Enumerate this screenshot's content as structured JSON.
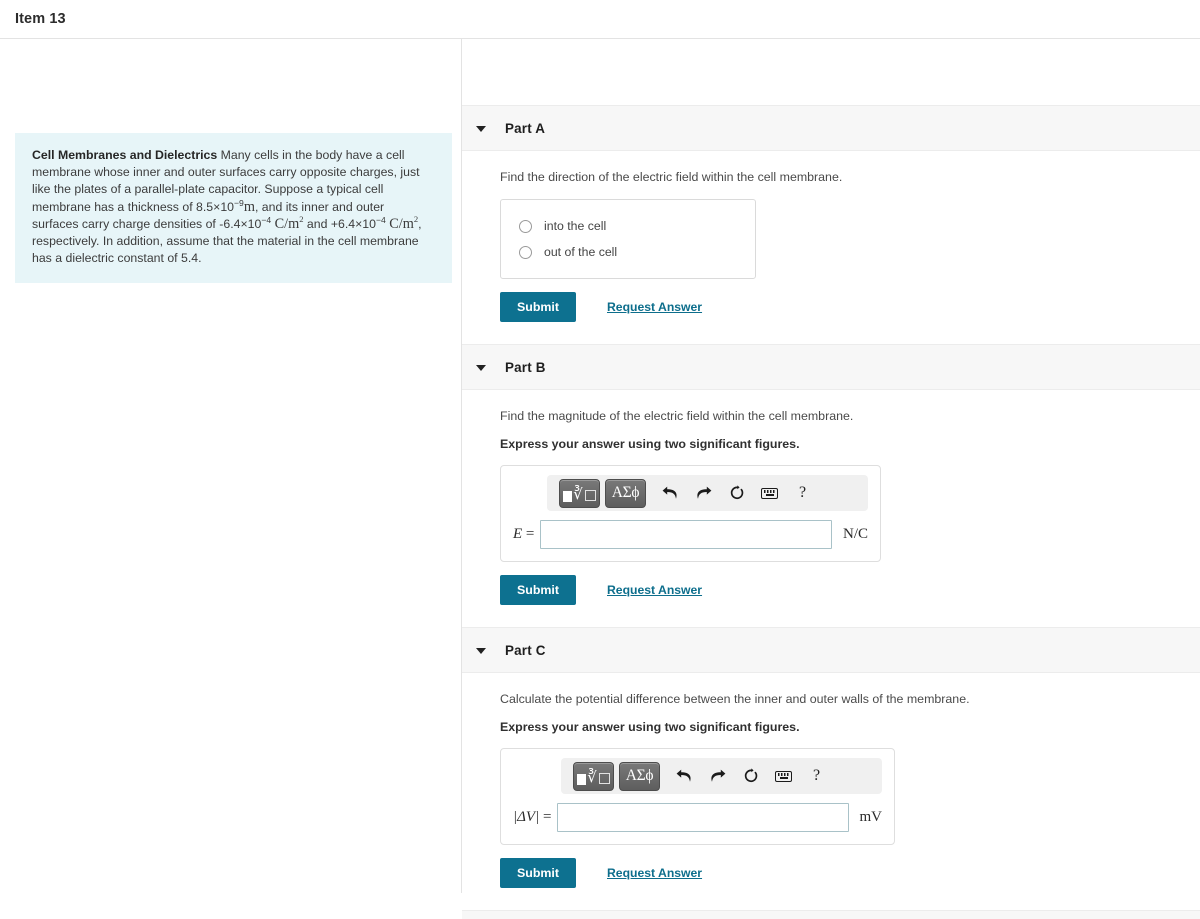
{
  "topbar": {
    "title": "Item 13"
  },
  "statement": {
    "heading": "Cell Membranes and Dielectrics",
    "text_1": " Many cells in the body have a cell membrane whose inner and outer surfaces carry opposite charges, just like the plates of a parallel-plate capacitor. Suppose a typical cell membrane has a thickness of 8.5×10",
    "exp_1": "−9",
    "unit_1": "m",
    "text_2": ", and its inner and outer surfaces carry charge densities of -6.4×10",
    "exp_2": "−4",
    "unit_2": "C/m",
    "unit_2_sup": "2",
    "text_3": " and +6.4×10",
    "exp_3": "−4",
    "unit_3": "C/m",
    "unit_3_sup": "2",
    "text_4": ", respectively. In addition, assume that the material in the cell membrane has a dielectric constant of 5.4."
  },
  "math_toolbar": {
    "template_button": "math-template-button",
    "greek_button": "ΑΣϕ",
    "undo": "undo-icon",
    "redo": "redo-icon",
    "reset": "reset-icon",
    "keyboard": "keyboard-icon",
    "help": "?"
  },
  "common": {
    "submit_label": "Submit",
    "request_answer_label": "Request Answer",
    "sigfigs_note": "Express your answer using two significant figures."
  },
  "parts": [
    {
      "label": "Part A",
      "question": "Find the direction of the electric field within the cell membrane.",
      "choices": [
        {
          "label": "into the cell"
        },
        {
          "label": "out of the cell"
        }
      ]
    },
    {
      "label": "Part B",
      "question": "Find the magnitude of the electric field within the cell membrane.",
      "answer_symbol": "E",
      "answer_equals": " =",
      "answer_value": "",
      "unit": "N/C"
    },
    {
      "label": "Part C",
      "question": "Calculate the potential difference between the inner and outer walls of the membrane.",
      "answer_symbol": "|ΔV|",
      "answer_equals": " =",
      "answer_value": "",
      "unit": "mV"
    }
  ],
  "colors": {
    "accent": "#0d7190",
    "statement_bg": "#e7f5f8",
    "part_header_bg": "#f7f7f7",
    "input_border": "#a9c2c8"
  }
}
